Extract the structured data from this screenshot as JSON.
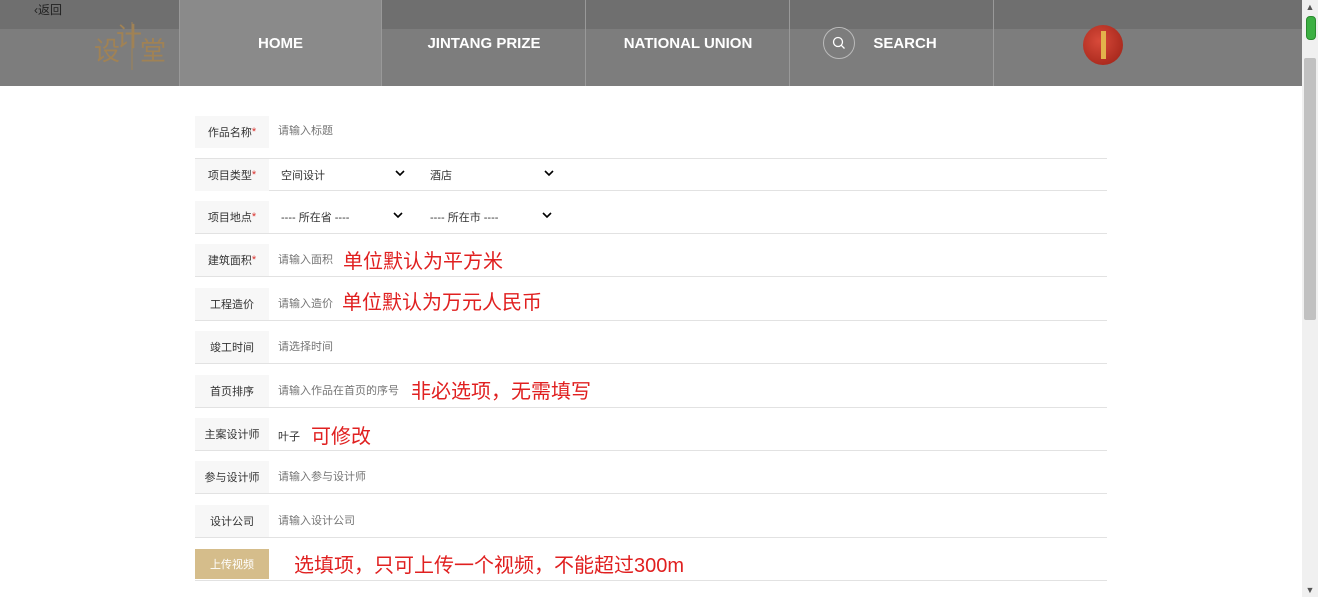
{
  "header": {
    "back_label": "返回",
    "logo_text": "设计堂",
    "nav": [
      {
        "label": "HOME"
      },
      {
        "label": "JINTANG PRIZE"
      },
      {
        "label": "NATIONAL UNION"
      }
    ],
    "search_label": "SEARCH"
  },
  "form": {
    "work_name": {
      "label": "作品名称",
      "required": "*",
      "placeholder": "请输入标题"
    },
    "project_type": {
      "label": "项目类型",
      "required": "*",
      "select1": "空间设计",
      "select2": "酒店"
    },
    "project_location": {
      "label": "项目地点",
      "required": "*",
      "select1": "---- 所在省 ----",
      "select2": "---- 所在市 ----"
    },
    "building_area": {
      "label": "建筑面积",
      "required": "*",
      "placeholder": "请输入面积"
    },
    "project_cost": {
      "label": "工程造价",
      "placeholder": "请输入造价"
    },
    "completion_time": {
      "label": "竣工时间",
      "placeholder": "请选择时间"
    },
    "homepage_order": {
      "label": "首页排序",
      "placeholder": "请输入作品在首页的序号"
    },
    "lead_designer": {
      "label": "主案设计师",
      "value": "叶子"
    },
    "participating_designers": {
      "label": "参与设计师",
      "placeholder": "请输入参与设计师"
    },
    "design_company": {
      "label": "设计公司",
      "placeholder": "请输入设计公司"
    },
    "upload_video": {
      "label": "上传视频"
    }
  },
  "annotations": {
    "area_note": "单位默认为平方米",
    "cost_note": "单位默认为万元人民币",
    "order_note": "非必选项，无需填写",
    "designer_note": "可修改",
    "video_note": "选填项，只可上传一个视频，不能超过300m"
  },
  "colors": {
    "header_bg": "#7d7d7d",
    "upload_button": "#d5bd8b",
    "required_star": "#d9302c",
    "annotation": "#e02020"
  },
  "icons": [
    "back-chevron-icon",
    "search-icon",
    "chevron-down-icon"
  ]
}
